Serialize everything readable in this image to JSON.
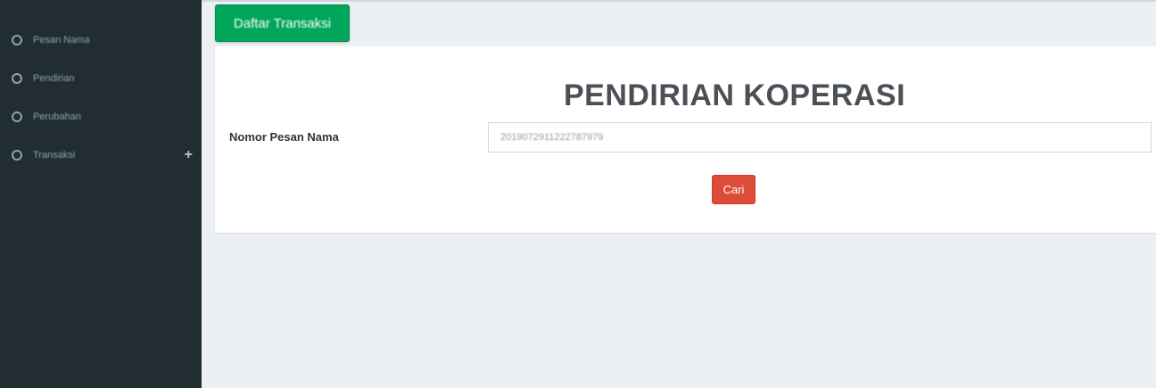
{
  "sidebar": {
    "items": [
      {
        "label": "Pesan Nama",
        "icon": "circle-o-icon"
      },
      {
        "label": "Pendirian",
        "icon": "circle-o-icon"
      },
      {
        "label": "Perubahan",
        "icon": "circle-o-icon"
      },
      {
        "label": "Transaksi",
        "icon": "circle-o-icon",
        "expand_icon": "plus-icon",
        "expand_glyph": "+"
      }
    ]
  },
  "header": {
    "daftar_button_label": "Daftar Transaksi"
  },
  "form": {
    "title": "PENDIRIAN KOPERASI",
    "field_label": "Nomor Pesan Nama",
    "field_value": "2019072911222787979",
    "submit_label": "Cari"
  },
  "colors": {
    "sidebar_bg": "#222d32",
    "content_bg": "#ecf0f5",
    "success": "#00a65a",
    "danger": "#dd4b39"
  }
}
